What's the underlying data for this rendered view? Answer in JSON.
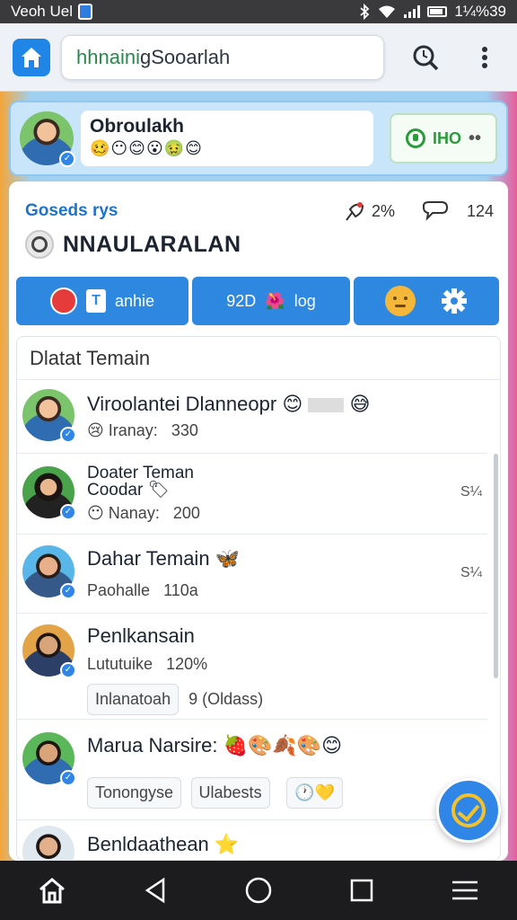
{
  "status_bar": {
    "carrier": "Veoh Uel",
    "time": "1¼%39"
  },
  "top_bar": {
    "url_first": "hhnaini",
    "url_rest": "gSooarlah"
  },
  "profile": {
    "name": "Obroulakh",
    "emojis": "🥴😶😊😮🤢😊",
    "status_value": "IHO"
  },
  "header": {
    "section_label": "Goseds rys",
    "metric_1": "2%",
    "metric_2": "124",
    "title": "NNAULARALAN"
  },
  "tabs": [
    {
      "label": "anhie"
    },
    {
      "label": "92D",
      "label_2": "log"
    },
    {
      "label": ""
    }
  ],
  "list": {
    "title": "Dlatat Temain",
    "items": [
      {
        "name": "Viroolantei Dlanneopr",
        "name_emoji": "😊",
        "name_emoji_2": "😅",
        "sub_emoji": "😢",
        "sub_label": "Iranay:",
        "sub_value": "330",
        "meta": ""
      },
      {
        "name": "Doater Teman",
        "name_line_2": "Coodar",
        "sub_emoji": "😶",
        "sub_label": "Nanay:",
        "sub_value": "200",
        "meta": "S¼"
      },
      {
        "name": "Dahar Temain",
        "name_emoji": "🦋",
        "sub_label": "Paohalle",
        "sub_value": "110a",
        "meta": "S¼"
      },
      {
        "name": "Penlkansain",
        "sub_label": "Lututuike",
        "sub_value": "120%",
        "chip_1": "Inlanatoah",
        "chip_2": "9 (Oldass)"
      },
      {
        "name": "Marua Narsire:",
        "name_emoji": "🍓🎨🍂🎨😊",
        "chip_1": "Tonongyse",
        "chip_2": "Ulabests",
        "chip_3": "💛"
      },
      {
        "name": "Benldaathean",
        "name_emoji": "⭐"
      }
    ]
  },
  "colors": {
    "accent": "#2f88e0",
    "status_green": "#2a9a3a",
    "fab_yellow": "#f3c22b"
  }
}
